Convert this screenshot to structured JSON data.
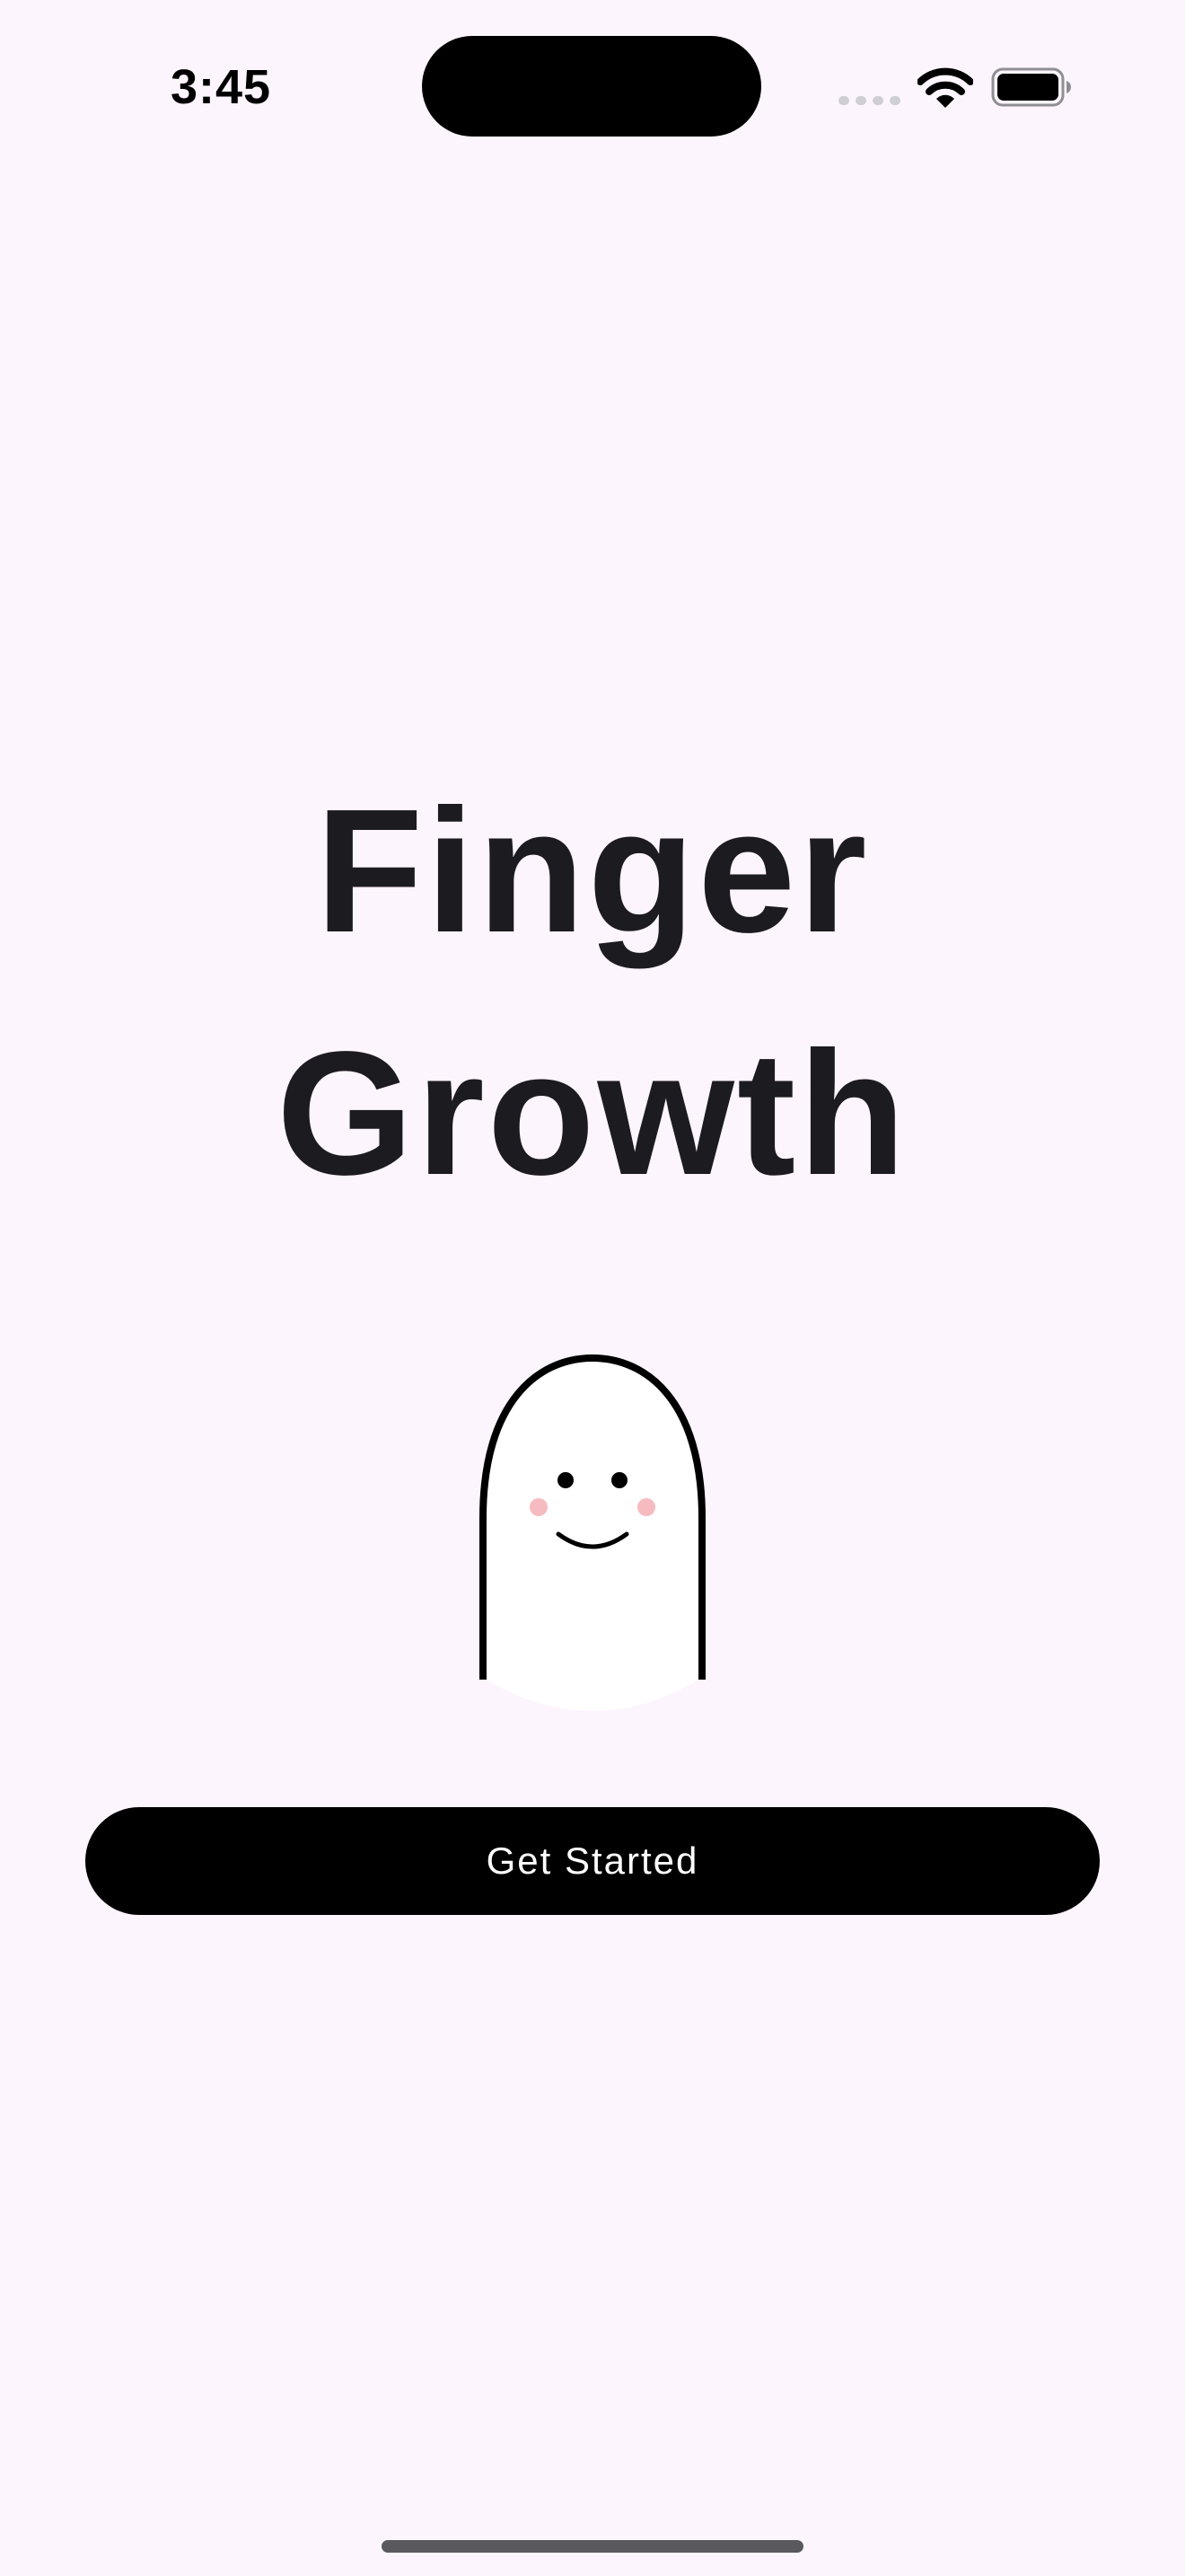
{
  "colors": {
    "background": "#FDF5FD",
    "text": "#1C1B20",
    "button_bg": "#000000",
    "button_text": "#FFFFFF",
    "blush": "#F6BBC0",
    "home_indicator": "#5A5A5E"
  },
  "status_bar": {
    "time": "3:45",
    "icons": [
      "cellular-signal-icon",
      "wifi-icon",
      "battery-icon"
    ]
  },
  "main": {
    "title": "Finger\nGrowth",
    "mascot_icon": "smiling-finger-mascot",
    "button_label": "Get Started"
  }
}
